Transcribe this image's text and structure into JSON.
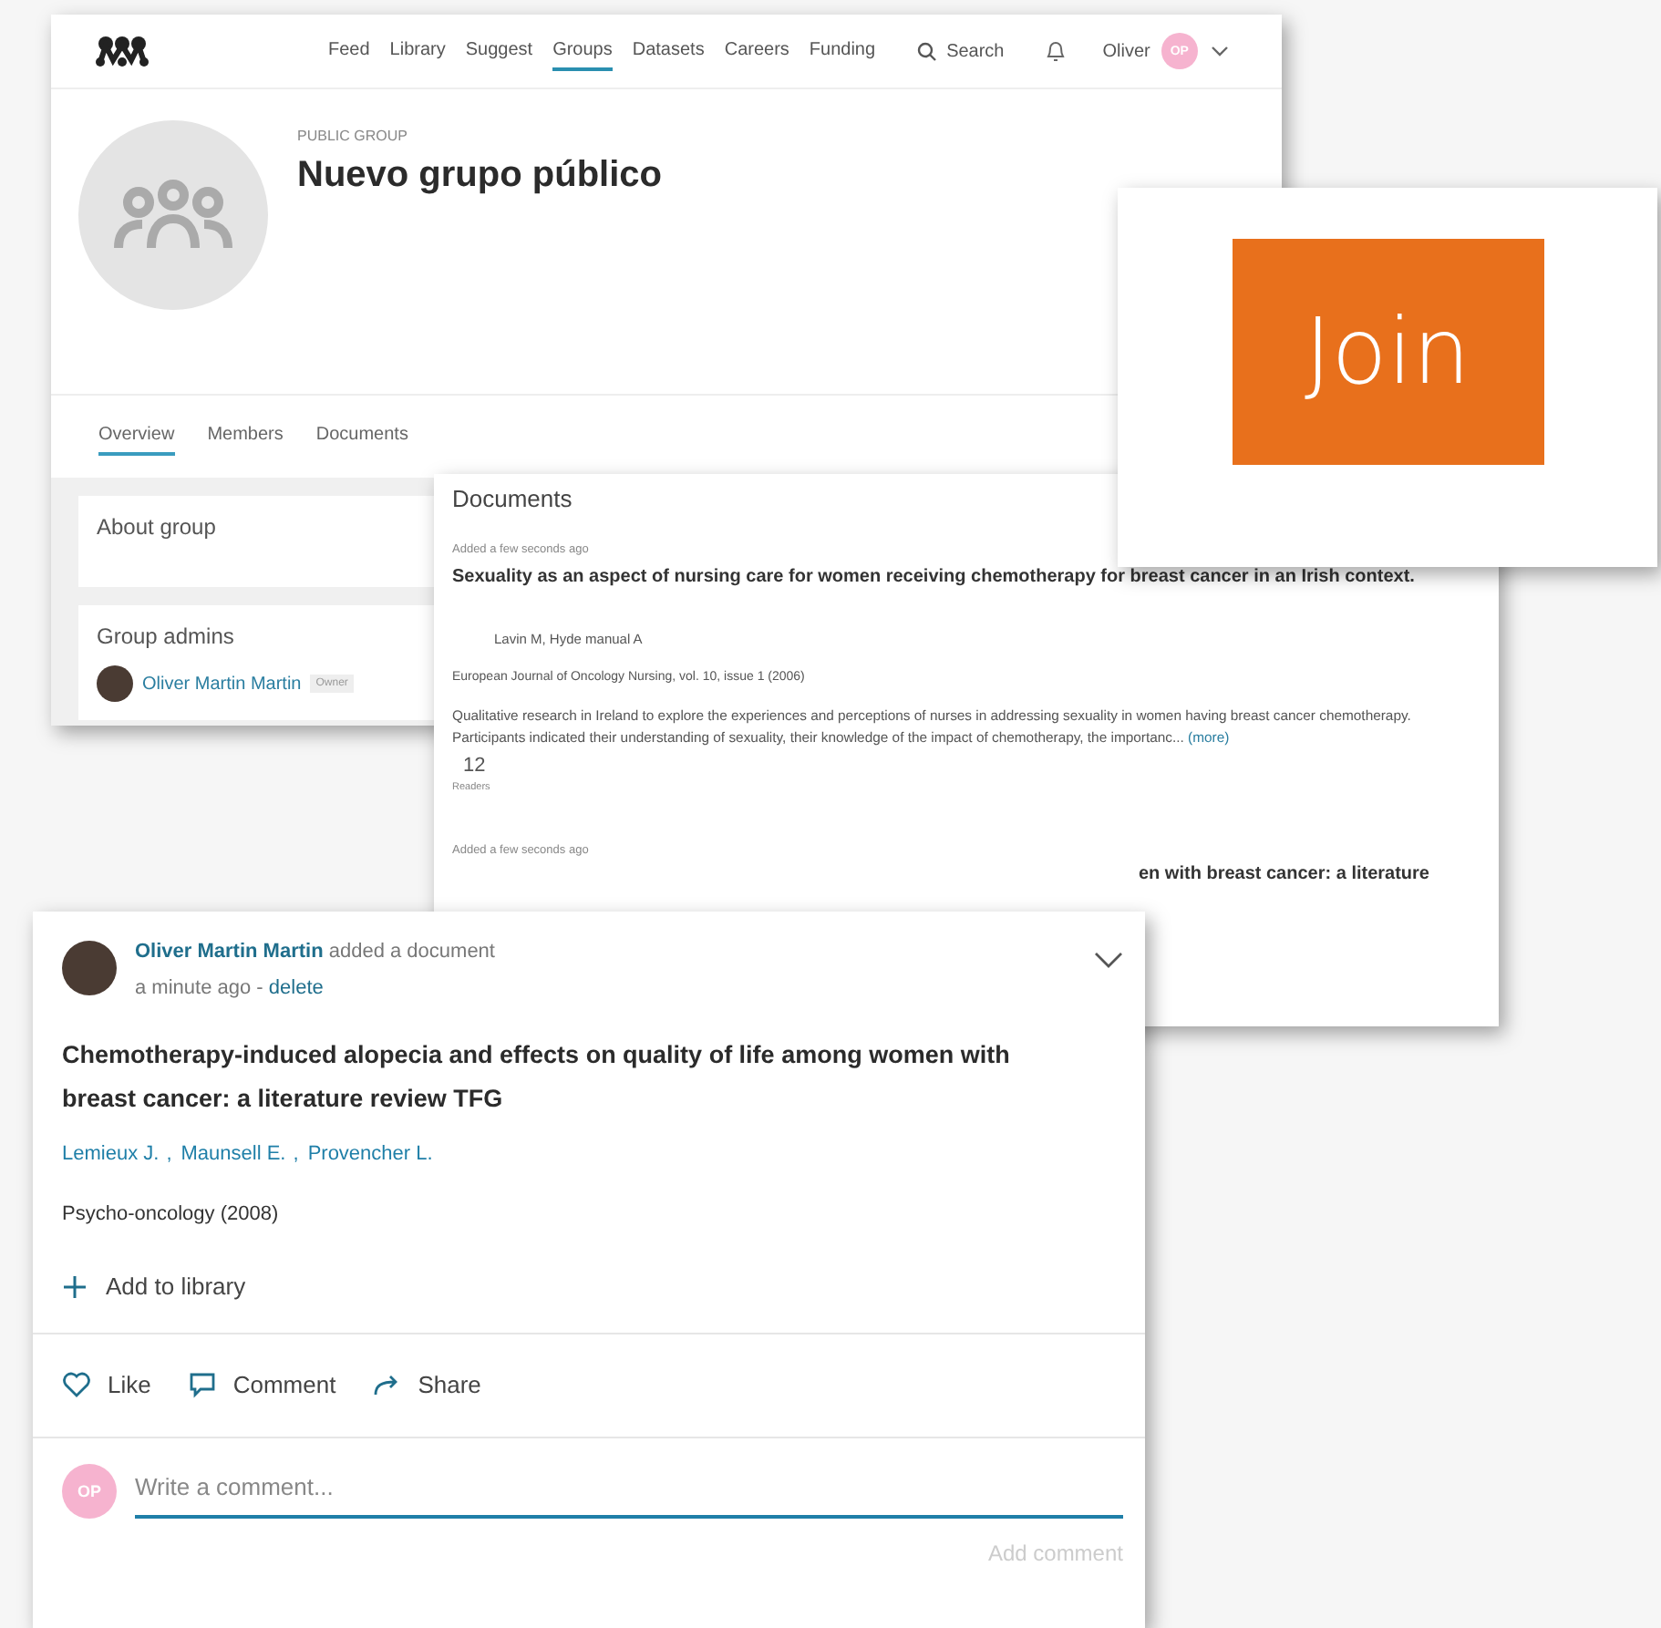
{
  "nav": {
    "items": [
      {
        "label": "Feed",
        "selected": false
      },
      {
        "label": "Library",
        "selected": false
      },
      {
        "label": "Suggest",
        "selected": false
      },
      {
        "label": "Groups",
        "selected": true
      },
      {
        "label": "Datasets",
        "selected": false
      },
      {
        "label": "Careers",
        "selected": false
      },
      {
        "label": "Funding",
        "selected": false
      }
    ],
    "search": "Search",
    "user": "Oliver",
    "user_initials": "OP"
  },
  "group": {
    "type_label": "PUBLIC GROUP",
    "name": "Nuevo grupo público",
    "tabs": [
      {
        "label": "Overview",
        "selected": true
      },
      {
        "label": "Members",
        "selected": false
      },
      {
        "label": "Documents",
        "selected": false
      }
    ]
  },
  "sidebar": {
    "about_title": "About group",
    "admins_title": "Group admins",
    "admins": [
      {
        "name": "Oliver Martin Martin",
        "role": "Owner"
      }
    ]
  },
  "documents": {
    "title": "Documents",
    "items": [
      {
        "added": "Added a few seconds ago",
        "title": "Sexuality as an aspect of nursing care for women receiving chemotherapy for breast cancer in an Irish context.",
        "authors": "Lavin M, Hyde manual A",
        "source": "European Journal of Oncology Nursing, vol. 10, issue 1 (2006)",
        "abstract": "Qualitative research in Ireland to explore the experiences and perceptions of nurses in addressing sexuality in women having breast cancer chemotherapy. Participants indicated their understanding of sexuality, their knowledge of the impact of chemotherapy, the importanc...",
        "more": "(more)",
        "readers": "12",
        "readers_label": "Readers"
      }
    ],
    "next_added": "Added a few seconds ago",
    "next_title_fragment": "en with breast cancer: a literature"
  },
  "join_button": "Join",
  "activity": {
    "user": "Oliver Martin Martin",
    "action": "added a document",
    "time": "a minute ago -",
    "delete": "delete",
    "title": "Chemotherapy-induced alopecia and effects on quality of life among women with breast cancer: a literature review TFG",
    "authors": [
      "Lemieux J.",
      "Maunsell E.",
      "Provencher L."
    ],
    "author_separator": ",",
    "source": "Psycho-oncology (2008)",
    "add_to_library": "Add to library",
    "actions": [
      {
        "kind": "like",
        "label": "Like"
      },
      {
        "kind": "comment",
        "label": "Comment"
      },
      {
        "kind": "share",
        "label": "Share"
      }
    ],
    "comment_placeholder": "Write a comment...",
    "commenter_initials": "OP",
    "submit": "Add comment"
  }
}
